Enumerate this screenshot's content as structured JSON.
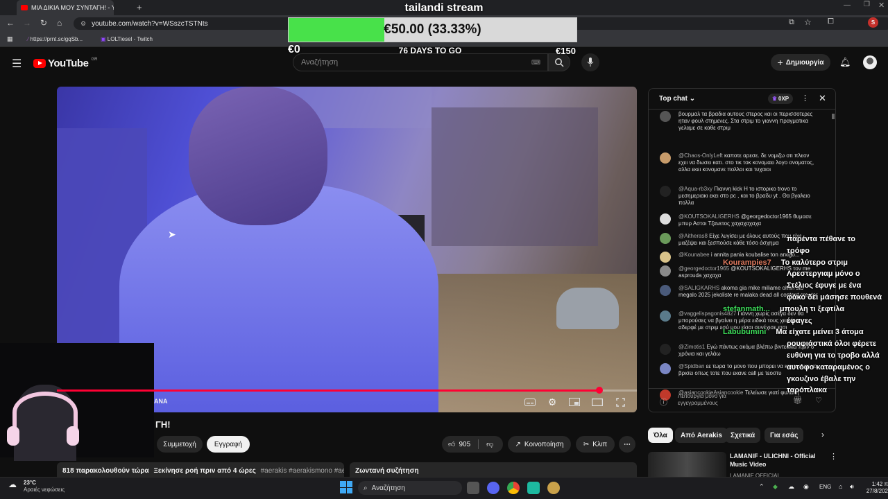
{
  "browser": {
    "tab_title": "ΜΙΑ ΔΙΚΙΑ ΜΟΥ ΣΥΝΤΑΓΗ! - Yo",
    "url": "youtube.com/watch?v=WSszcTSTNts",
    "bookmarks": [
      {
        "label": "https://prnt.sc/gqSb..."
      },
      {
        "label": "LOLTiesel - Twitch"
      }
    ],
    "profile_initial": "S"
  },
  "youtube": {
    "logo_text": "YouTube",
    "region": "GR",
    "search_placeholder": "Αναζήτηση",
    "create_label": "Δημιουργία"
  },
  "goal": {
    "title": "tailandi stream",
    "amount_text": "€50.00 (33.33%)",
    "progress_percent": 33.33,
    "min_label": "€0",
    "days_label": "76 DAYS TO GO",
    "max_label": "€150"
  },
  "video": {
    "progress_fraction": 0.935,
    "corner_label": "ANA",
    "title_fragment": "ΓΗ!"
  },
  "actions": {
    "join_label": "Συμμετοχή",
    "subscribe_label": "Εγγραφή",
    "like_count": "905",
    "share_label": "Κοινοποίηση",
    "clip_label": "Κλιπ"
  },
  "description": {
    "viewers": "818 παρακολουθούν τώρα",
    "started": "Ξεκίνησε ροή πριν από 4 ώρες",
    "tags": "#aerakis #aerakismono #aeraki"
  },
  "live_chat_label": "Ζωντανή συζήτηση",
  "chat": {
    "header": "Top chat",
    "points": "0XP",
    "footer": "Λειτουργία μόνο για εγγεγραμμένους",
    "messages": [
      {
        "author": "",
        "text": "βουρμαλ τα βραδια αυτους στερος και οι περισσοτερες ηταν φουλ στημενες. Στα στριμ το γιαννη πραγματικα γελαμε σε καθε στριμ",
        "color": "#555"
      },
      {
        "author": "@Chaos-OnlyLeft",
        "text": "καποτε αρεσε. δε νομιζω οτι πλεον εχει να δωσει κατι. στο τικ τοκ κονομαει λογο ονοματος, αλλα εκει κονομανε πολλοι και τυχαιοι",
        "color": "#c79b6a"
      },
      {
        "author": "@Aqua-rb3xy",
        "text": "Πιαννη kick H το ιστορικο trovo το μεσημεριακι εκει στο pc , και το βραδυ yt . Θα βγαλειο πολλα",
        "color": "#222"
      },
      {
        "author": "@KOUTSOKALIGERHS",
        "text": "@georgedoctor1965 θυμασε μπυρ Αστοι Τζανετος χαχαχαχαχα",
        "color": "#ddd"
      },
      {
        "author": "@Aitheras8",
        "text": "Είχε λυγίσει με όλους αυτούς που είχε μαζέψει και ξεσπούσε κάθε τόσο άσχημα",
        "color": "#6a9a5a"
      },
      {
        "author": "@Kounabee",
        "text": "i annita pania koubalise ton arxigo...",
        "color": "#d9c38a"
      },
      {
        "author": "@georgedoctor1965",
        "text": "@KOUTSOKALIGERHS τον me asprouda χαχαχα",
        "color": "#8a8a8a"
      },
      {
        "author": "@SALIGKARHS",
        "text": "akoma gia mike miliame ohhh sto megalo 2025 jekoliste re malaka dead all content creator",
        "color": "#4a5a7a"
      },
      {
        "author": "@vaggelispagonis4827",
        "text": "Γιάννη χωρίς ασέγα δεν θα μπορούσες να βγαίνει η μέρα ειδικά τους χειμώνα αδερφέ με στριμ εσύ μου είσαι συνέχισε ετσι",
        "color": "#5a7a8a"
      },
      {
        "author": "@Zimotis1",
        "text": "Εγώ πάντως ακόμα βλέπω βιντεάκια πριν 6 χρόνια και γελάω",
        "color": "#222"
      },
      {
        "author": "@Spidban",
        "text": "εε τωρα το μονο που μπορει να κανει ειναι να βρισει οπως τοτε που εκανε call με τεοστυ",
        "color": "#7a86c4"
      },
      {
        "author": "@asiancookieAsiancookie",
        "text": "Τελείωσε γιατί φυλακή",
        "color": "#c0392b"
      }
    ]
  },
  "overlay_chat": [
    {
      "name": "",
      "text": "παρέντα πέθανε το"
    },
    {
      "name": "",
      "text": "τρόφο"
    },
    {
      "name": "Kourampies7",
      "text": "Το καλύτερο στριμ"
    },
    {
      "name": "",
      "text": "Λρεστεργιαμ μόνο ο"
    },
    {
      "name": "",
      "text": "Στέλιος έφυγε με ένα"
    },
    {
      "name": "",
      "text": "φάκο δει μάσησε πουθενά"
    },
    {
      "name": "stefanmath...",
      "text": "μπουλη τι ξεφτίλα"
    },
    {
      "name": "",
      "text": "έφαγες"
    },
    {
      "name": "Labubumini",
      "text": "Μα είχατε μείνει 3 άτομα"
    },
    {
      "name": "",
      "text": "ρουφιάστικά όλοι φέρετε"
    },
    {
      "name": "",
      "text": "ευθύνη για το τροβο αλλά"
    },
    {
      "name": "",
      "text": "αυτόφο καταραμένος ο"
    },
    {
      "name": "",
      "text": "γκουζινο έβαλε την"
    },
    {
      "name": "",
      "text": "ταρόπλακα"
    }
  ],
  "chips": [
    {
      "label": "Όλα",
      "active": true
    },
    {
      "label": "Από Aerakis",
      "active": false
    },
    {
      "label": "Σχετικά",
      "active": false
    },
    {
      "label": "Για εσάς",
      "active": false
    }
  ],
  "recommendation": {
    "title": "LAMANIF - ULICHNI - Official Music Video",
    "channel": "LAMANIF OFFICIAL"
  },
  "taskbar": {
    "temperature": "23°C",
    "weather": "Αραιές νεφώσεις",
    "search_label": "Αναζήτηση",
    "language": "ENG",
    "time": "1:42 π",
    "date": "27/8/202"
  }
}
